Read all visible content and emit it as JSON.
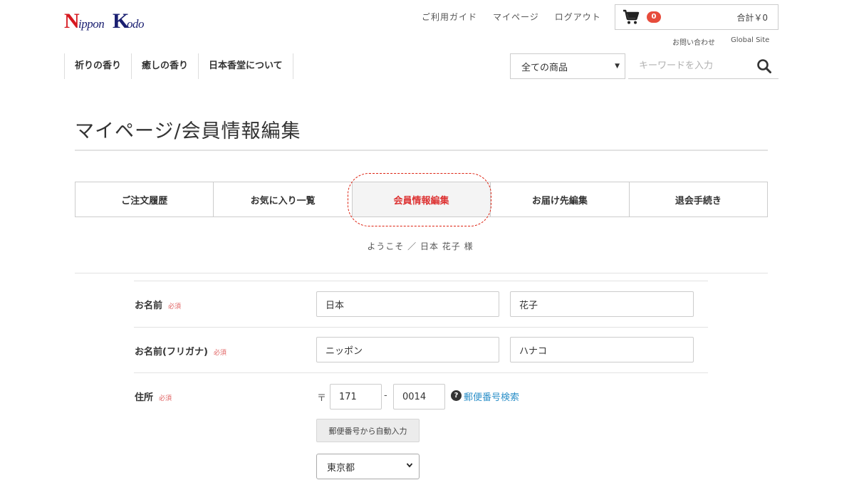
{
  "logo": {
    "n": "N",
    "ippon": "ippon",
    "k": "K",
    "odo": "odo"
  },
  "header": {
    "top_links": [
      "ご利用ガイド",
      "マイページ",
      "ログアウト"
    ],
    "cart": {
      "count": "0",
      "total": "合計￥0"
    },
    "sub_links": [
      "お問い合わせ",
      "Global Site"
    ],
    "categories": [
      "祈りの香り",
      "癒しの香り",
      "日本香堂について"
    ],
    "search": {
      "category": "全ての商品",
      "placeholder": "キーワードを入力"
    }
  },
  "page": {
    "title": "マイページ/会員情報編集",
    "tabs": [
      {
        "label": "ご注文履歴",
        "active": false
      },
      {
        "label": "お気に入り一覧",
        "active": false
      },
      {
        "label": "会員情報編集",
        "active": true
      },
      {
        "label": "お届け先編集",
        "active": false
      },
      {
        "label": "退会手続き",
        "active": false
      }
    ],
    "welcome": "ようこそ ／ 日本 花子 様"
  },
  "form": {
    "required_label": "必須",
    "name": {
      "label": "お名前",
      "last": "日本",
      "first": "花子"
    },
    "kana": {
      "label": "お名前(フリガナ)",
      "last": "ニッポン",
      "first": "ハナコ"
    },
    "address": {
      "label": "住所",
      "postal_mark": "〒",
      "zip1": "171",
      "zip2": "0014",
      "zip_search_link": "郵便番号検索",
      "auto_fill_button": "郵便番号から自動入力",
      "prefecture": "東京都"
    }
  },
  "colors": {
    "accent": "#d33333",
    "link": "#2b8fc8",
    "badge": "#e74c3c"
  }
}
